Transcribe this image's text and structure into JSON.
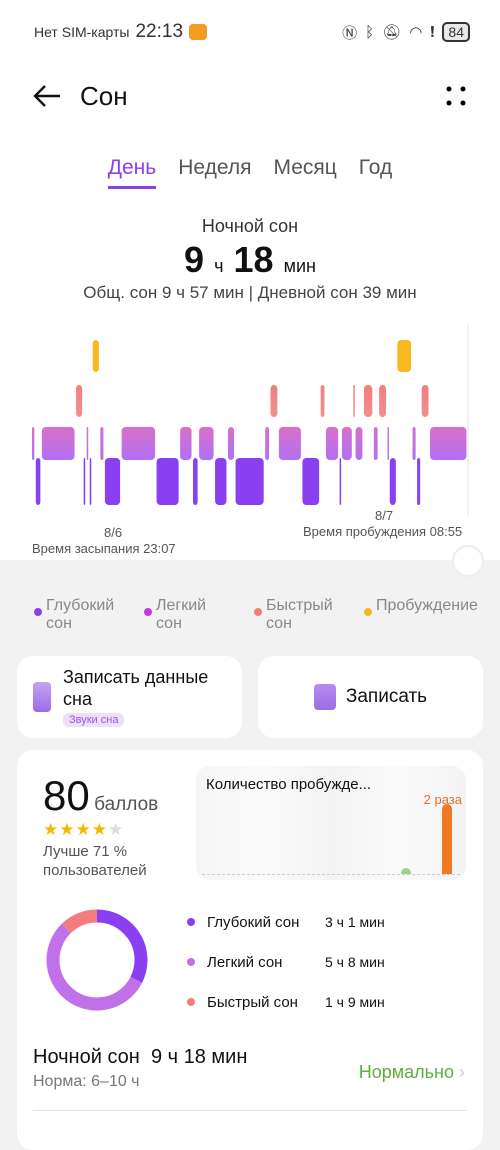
{
  "status": {
    "carrier": "Нет SIM-карты",
    "time": "22:13",
    "battery": "84",
    "icons": [
      "nfc-icon",
      "bluetooth-icon",
      "bell-off-icon",
      "wifi-icon",
      "alert-icon"
    ]
  },
  "header": {
    "title": "Сон"
  },
  "tabs": [
    {
      "label": "День",
      "active": true
    },
    {
      "label": "Неделя"
    },
    {
      "label": "Месяц"
    },
    {
      "label": "Год"
    }
  ],
  "summary": {
    "label": "Ночной сон",
    "hours": "9",
    "h_unit": "ч",
    "minutes": "18",
    "m_unit": "мин",
    "detail": "Общ. сон 9 ч 57 мин | Дневной сон 39 мин"
  },
  "chart_data": {
    "type": "hypnogram",
    "start_date": "8/6",
    "start_label": "Время засыпания 23:07",
    "end_date": "8/7",
    "end_label": "Время пробуждения 08:55",
    "stages": [
      "awake",
      "rem",
      "light",
      "deep"
    ],
    "colors": {
      "deep": "#8a3ff0",
      "light": "#c070e0",
      "rem": "#f47c7c",
      "awake": "#f9b820"
    },
    "segments": [
      [
        "light",
        5
      ],
      [
        "deep",
        8
      ],
      [
        "light",
        45
      ],
      [
        "rem",
        10
      ],
      [
        "deep",
        4
      ],
      [
        "light",
        4
      ],
      [
        "deep",
        4
      ],
      [
        "awake",
        10
      ],
      [
        "light",
        6
      ],
      [
        "deep",
        22
      ],
      [
        "light",
        46
      ],
      [
        "deep",
        31
      ],
      [
        "light",
        17
      ],
      [
        "deep",
        8
      ],
      [
        "light",
        21
      ],
      [
        "deep",
        17
      ],
      [
        "light",
        10
      ],
      [
        "deep",
        39
      ],
      [
        "light",
        7
      ],
      [
        "rem",
        11
      ],
      [
        "light",
        31
      ],
      [
        "deep",
        24
      ],
      [
        "rem",
        7
      ],
      [
        "light",
        18
      ],
      [
        "deep",
        3
      ],
      [
        "light",
        15
      ],
      [
        "rem",
        3
      ],
      [
        "light",
        11
      ],
      [
        "rem",
        13
      ],
      [
        "light",
        7
      ],
      [
        "rem",
        11
      ],
      [
        "light",
        3
      ],
      [
        "deep",
        10
      ],
      [
        "awake",
        20
      ],
      [
        "light",
        6
      ],
      [
        "deep",
        6
      ],
      [
        "rem",
        11
      ],
      [
        "light",
        50
      ]
    ]
  },
  "legend": [
    {
      "label": "Глубокий сон",
      "color": "#8a3ff0"
    },
    {
      "label": "Легкий сон",
      "color": "#c03ad8"
    },
    {
      "label": "Быстрый сон",
      "color": "#f47c7c"
    },
    {
      "label": "Пробуждение",
      "color": "#f9b820"
    }
  ],
  "actions": {
    "record_data": "Записать данные сна",
    "sounds": "Звуки сна",
    "record": "Записать"
  },
  "score": {
    "value": "80",
    "unit": "баллов",
    "stars": 4,
    "max_stars": 5,
    "better": "Лучше 71 %",
    "users": "пользователей"
  },
  "wakeups": {
    "title": "Количество пробужде...",
    "value": "2 раза"
  },
  "breakdown": [
    {
      "label": "Глубокий сон",
      "value": "3 ч 1 мин",
      "minutes": 181,
      "color": "#8a3ff0"
    },
    {
      "label": "Легкий сон",
      "value": "5 ч 8 мин",
      "minutes": 308,
      "color": "#c070e8"
    },
    {
      "label": "Быстрый сон",
      "value": "1 ч 9 мин",
      "minutes": 69,
      "color": "#f47c7c"
    }
  ],
  "night": {
    "label": "Ночной сон",
    "value": "9 ч 18 мин",
    "norm": "Норма: 6–10 ч",
    "status": "Нормально",
    "status_color": "#5cb03a"
  }
}
